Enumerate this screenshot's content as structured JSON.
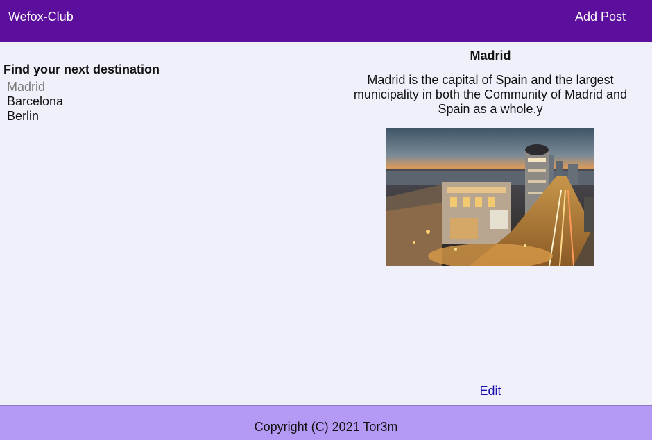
{
  "header": {
    "brand": "Wefox-Club",
    "add_post": "Add Post",
    "bg_color": "#5c0e9c"
  },
  "sidebar": {
    "title": "Find your next destination",
    "items": [
      {
        "label": "Madrid",
        "active": true
      },
      {
        "label": "Barcelona",
        "active": false
      },
      {
        "label": "Berlin",
        "active": false
      }
    ]
  },
  "detail": {
    "title": "Madrid",
    "description": "Madrid is the capital of Spain and the largest municipality in both the Community of Madrid and Spain as a whole.y",
    "edit_label": "Edit"
  },
  "footer": {
    "copyright": "Copyright (C) 2021 Tor3m",
    "bg_color": "#b49af4"
  }
}
